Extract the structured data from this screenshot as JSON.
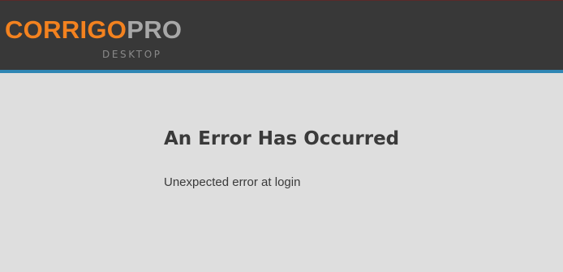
{
  "header": {
    "logo": {
      "primary": "CORRIGO",
      "secondary": "PRO",
      "subtitle": "DESKTOP"
    },
    "colors": {
      "background": "#383838",
      "accent_bar": "#2f86b4",
      "logo_primary": "#f3821f",
      "logo_secondary": "#a8a8a8"
    }
  },
  "main": {
    "title": "An Error Has Occurred",
    "message": "Unexpected error at login"
  }
}
